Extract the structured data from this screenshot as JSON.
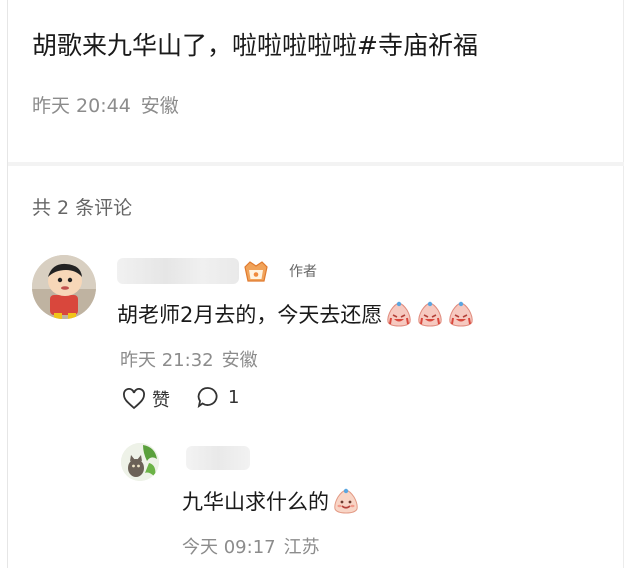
{
  "post": {
    "text": "胡歌来九华山了，啦啦啦啦啦",
    "hashtag": "#寺庙祈福",
    "time": "昨天 20:44",
    "location": "安徽"
  },
  "comments_header": {
    "count_text": "共 2 条评论"
  },
  "comment": {
    "author_tag": "作者",
    "text": "胡老师2月去的，今天去还愿",
    "time": "昨天 21:32",
    "location": "安徽",
    "like_label": "赞",
    "reply_count": "1",
    "emoji": "crying-face-emoji"
  },
  "reply": {
    "text": "九华山求什么的",
    "time": "今天 09:17",
    "location": "江苏",
    "emoji": "smiling-face-emoji"
  },
  "colors": {
    "primary_text": "#1a1a1a",
    "secondary_text": "#8c8c8c",
    "divider": "#f3f3f3"
  }
}
